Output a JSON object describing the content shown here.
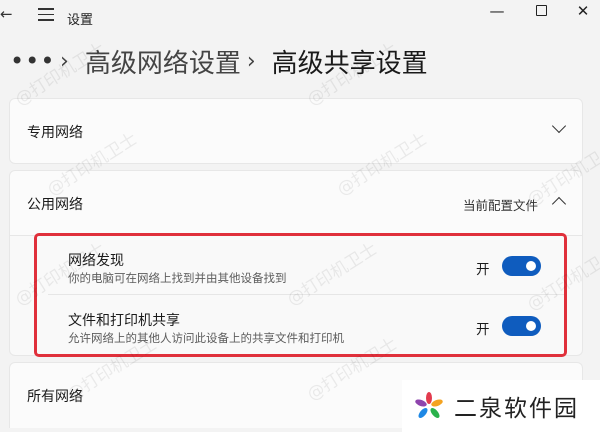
{
  "titlebar": {
    "back_icon": "arrow-left-icon",
    "menu_icon": "hamburger-icon",
    "title": "设置"
  },
  "breadcrumb": {
    "overflow": "•••",
    "parent": "高级网络设置",
    "current": "高级共享设置"
  },
  "sections": {
    "private": {
      "label": "专用网络",
      "expanded": false
    },
    "public": {
      "label": "公用网络",
      "profile_note": "当前配置文件",
      "expanded": true,
      "settings": [
        {
          "title": "网络发现",
          "description": "你的电脑可在网络上找到并由其他设备找到",
          "state": "开",
          "on": true
        },
        {
          "title": "文件和打印机共享",
          "description": "允许网络上的其他人访问此设备上的共享文件和打印机",
          "state": "开",
          "on": true
        }
      ]
    },
    "all": {
      "label": "所有网络"
    }
  },
  "watermark": "@打印机卫士",
  "brand": {
    "name": "二泉软件园"
  },
  "colors": {
    "toggle_on": "#0f5cbe",
    "highlight": "#e0303b",
    "background": "#f3f3f3"
  }
}
